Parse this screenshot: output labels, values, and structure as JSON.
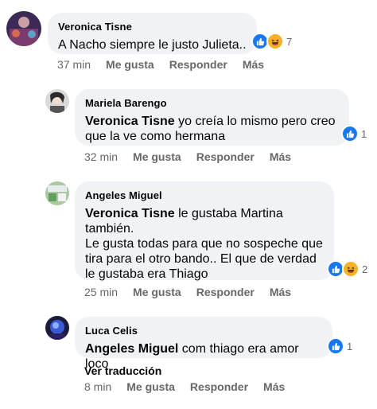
{
  "comments": [
    {
      "author": "Veronica Tisne",
      "mention": "",
      "text": "A Nacho siempre le justo Julieta..",
      "reaction_count": "7",
      "time": "37 min",
      "like": "Me gusta",
      "reply": "Responder",
      "more": "Más"
    },
    {
      "author": "Mariela Barengo",
      "mention": "Veronica Tisne",
      "text": " yo creía lo mismo pero creo que la ve como hermana",
      "reaction_count": "1",
      "time": "32 min",
      "like": "Me gusta",
      "reply": "Responder",
      "more": "Más"
    },
    {
      "author": "Angeles Miguel",
      "mention": "Veronica Tisne",
      "text": " le gustaba Martina también.",
      "text2": "Le gusta todas para que no sospeche que tira para el otro bando.. El que de verdad le gustaba era Thiago",
      "reaction_count": "2",
      "time": "25 min",
      "like": "Me gusta",
      "reply": "Responder",
      "more": "Más"
    },
    {
      "author": "Luca Celis",
      "mention": "Angeles Miguel",
      "text": " com thiago era amor loco",
      "reaction_count": "1",
      "translate": "Ver traducción",
      "time": "8 min",
      "like": "Me gusta",
      "reply": "Responder",
      "more": "Más"
    }
  ],
  "colors": {
    "bubble": "#f0f2f5",
    "meta": "#65676b",
    "like": "#1877f2",
    "haha": "#f7b125"
  },
  "icons": [
    "like-reaction-icon",
    "haha-reaction-icon"
  ]
}
